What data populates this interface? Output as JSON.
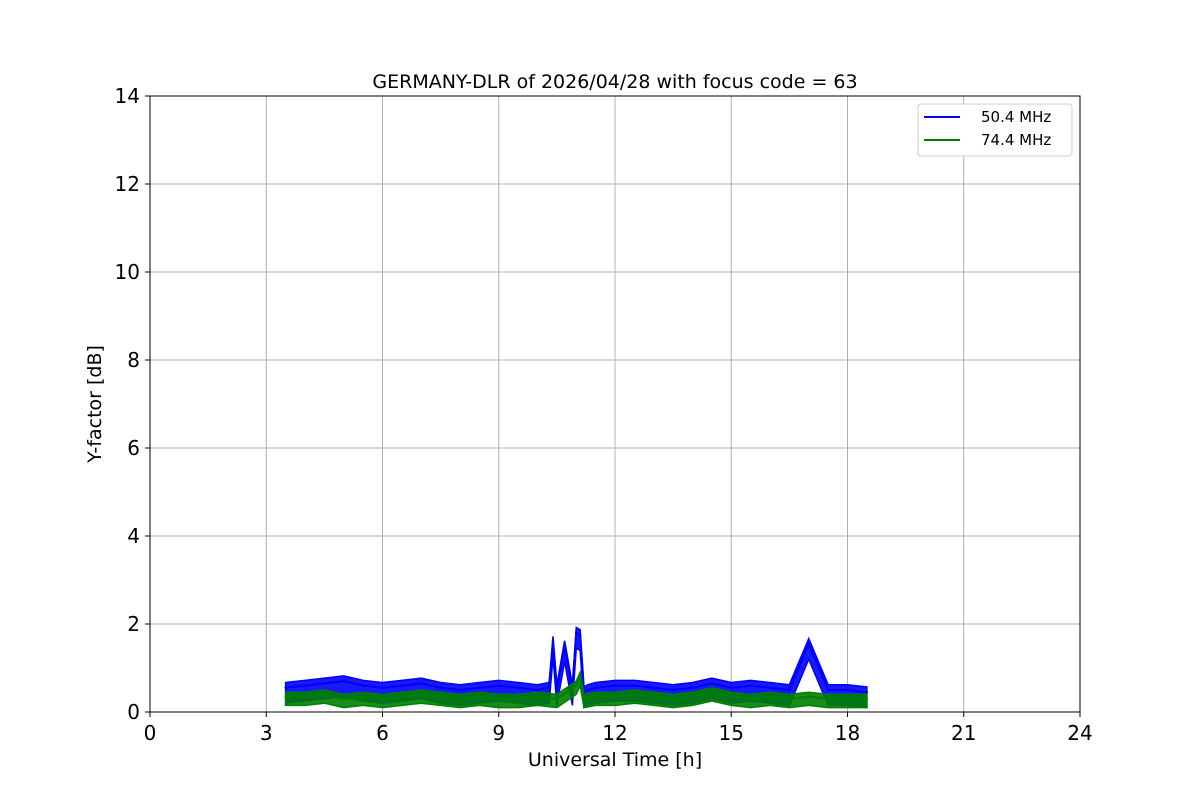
{
  "chart_data": {
    "type": "line",
    "title": "GERMANY-DLR of 2026/04/28 with focus code = 63",
    "xlabel": "Universal Time [h]",
    "ylabel": "Y-factor [dB]",
    "xlim": [
      0,
      24
    ],
    "ylim": [
      0,
      14
    ],
    "xticks": [
      0,
      3,
      6,
      9,
      12,
      15,
      18,
      21,
      24
    ],
    "yticks": [
      0,
      2,
      4,
      6,
      8,
      10,
      12,
      14
    ],
    "grid": true,
    "legend_position": "top-right",
    "series": [
      {
        "name": "50.4 MHz",
        "color": "#0000ff",
        "x": [
          3.5,
          4.0,
          4.5,
          5.0,
          5.5,
          6.0,
          6.5,
          7.0,
          7.5,
          8.0,
          8.5,
          9.0,
          9.5,
          10.0,
          10.3,
          10.4,
          10.5,
          10.7,
          10.9,
          11.0,
          11.1,
          11.2,
          11.3,
          11.5,
          12.0,
          12.5,
          13.0,
          13.5,
          14.0,
          14.5,
          15.0,
          15.5,
          16.0,
          16.5,
          17.0,
          17.5,
          18.0,
          18.5
        ],
        "y": [
          0.55,
          0.6,
          0.65,
          0.7,
          0.6,
          0.55,
          0.6,
          0.65,
          0.55,
          0.5,
          0.55,
          0.6,
          0.55,
          0.5,
          0.55,
          1.6,
          0.5,
          1.5,
          0.5,
          1.8,
          1.75,
          0.45,
          0.5,
          0.55,
          0.6,
          0.6,
          0.55,
          0.5,
          0.55,
          0.65,
          0.55,
          0.6,
          0.55,
          0.5,
          1.55,
          0.5,
          0.5,
          0.45
        ]
      },
      {
        "name": "74.4 MHz",
        "color": "#008000",
        "x": [
          3.5,
          4.0,
          4.5,
          5.0,
          5.5,
          6.0,
          6.5,
          7.0,
          7.5,
          8.0,
          8.5,
          9.0,
          9.5,
          10.0,
          10.5,
          11.0,
          11.1,
          11.2,
          11.5,
          12.0,
          12.5,
          13.0,
          13.5,
          14.0,
          14.5,
          15.0,
          15.5,
          16.0,
          16.5,
          17.0,
          17.5,
          18.0,
          18.5
        ],
        "y": [
          0.35,
          0.35,
          0.4,
          0.3,
          0.35,
          0.3,
          0.35,
          0.4,
          0.35,
          0.3,
          0.35,
          0.3,
          0.3,
          0.35,
          0.3,
          0.6,
          0.8,
          0.3,
          0.35,
          0.35,
          0.4,
          0.35,
          0.3,
          0.35,
          0.45,
          0.35,
          0.3,
          0.35,
          0.3,
          0.35,
          0.3,
          0.3,
          0.3
        ]
      }
    ]
  }
}
